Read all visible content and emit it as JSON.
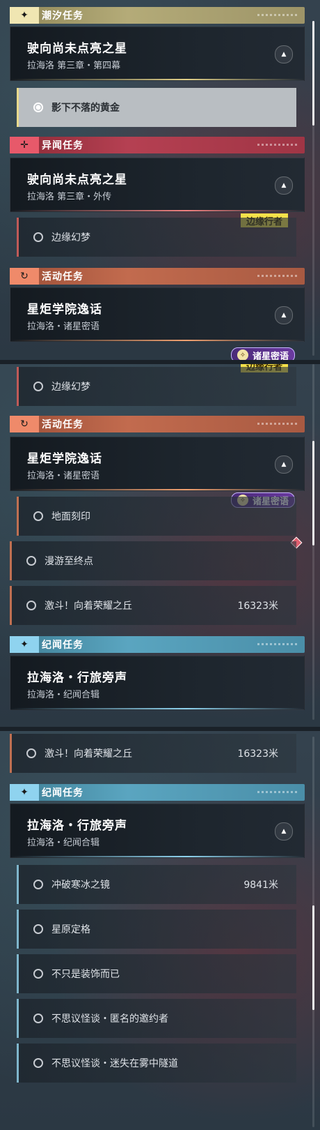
{
  "colors": {
    "tide": "#b4ab78",
    "anomaly": "#b54052",
    "event": "#c26b4e",
    "chronicle": "#5aa5c0"
  },
  "icons": {
    "tide": "sparkle-icon",
    "anomaly": "crosshair-icon",
    "event": "cycle-icon",
    "chronicle": "sparkle-icon",
    "expand": "triangle-up-icon"
  },
  "categories": {
    "tide": "潮汐任务",
    "anomaly": "异闻任务",
    "event": "活动任务",
    "chronicle": "纪闻任务"
  },
  "quests": {
    "star": {
      "title": "驶向尚未点亮之星",
      "subtitle": "拉海洛 第三章・第四幕"
    },
    "star_side": {
      "title": "驶向尚未点亮之星",
      "subtitle": "拉海洛 第三章・外传"
    },
    "academy": {
      "title": "星炬学院逸话",
      "subtitle": "拉海洛・诸星密语"
    },
    "chronicle": {
      "title": "拉海洛・行旅旁声",
      "subtitle": "拉海洛・纪闻合辑"
    }
  },
  "badges": {
    "edge": "边缘行者",
    "stars": "诸星密语"
  },
  "items": {
    "gold_shadow": "影下不落的黄金",
    "edge_dream": "边缘幻梦",
    "ground_seal": "地面刻印",
    "roam": "漫游至终点",
    "fight": "激斗！向着荣耀之丘",
    "fight_dist": "16323米",
    "ice": "冲破寒冰之镜",
    "ice_dist": "9841米",
    "plain": "星原定格",
    "deco": "不只是装饰而已",
    "mystery1": "不思议怪谈・匿名的邀约者",
    "mystery2": "不思议怪谈・迷失在雾中隧道"
  }
}
